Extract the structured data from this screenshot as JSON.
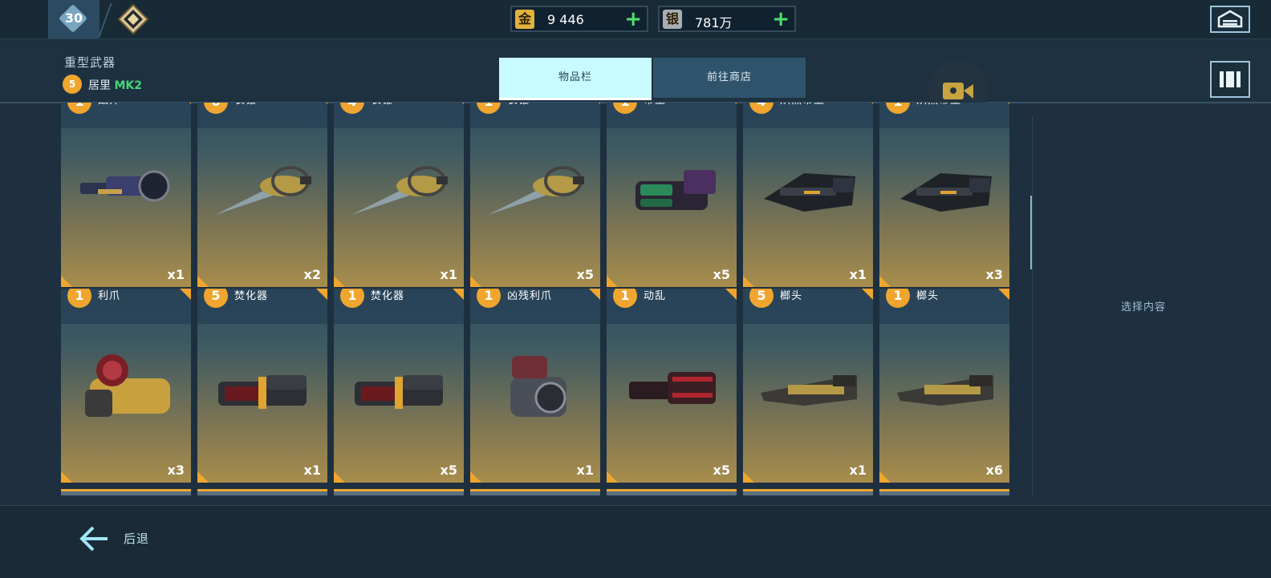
{
  "topbar": {
    "player_level": "30",
    "gold": {
      "icon_char": "金",
      "value": "9 446",
      "plus": "+"
    },
    "silver": {
      "icon_char": "银",
      "value": "781万",
      "plus": "+"
    }
  },
  "header": {
    "category_title": "重型武器",
    "bot_level": "5",
    "bot_name": "居里",
    "bot_mk": "MK2"
  },
  "tabs": [
    {
      "label": "物品栏",
      "active": true
    },
    {
      "label": "前往商店",
      "active": false
    }
  ],
  "items_row1": [
    {
      "level": "1",
      "name": "战斧",
      "qty": "x1",
      "icon": "gatling-blue"
    },
    {
      "level": "6",
      "name": "长锥",
      "qty": "x2",
      "icon": "lance-gold"
    },
    {
      "level": "4",
      "name": "长锥",
      "qty": "x1",
      "icon": "lance-gold"
    },
    {
      "level": "1",
      "name": "长锥",
      "qty": "x5",
      "icon": "lance-gold"
    },
    {
      "level": "1",
      "name": "帝王",
      "qty": "x5",
      "icon": "launcher-green"
    },
    {
      "level": "4",
      "name": "炽烈帝王",
      "qty": "x1",
      "icon": "launcher-dark"
    },
    {
      "level": "1",
      "name": "炽烈帝王",
      "qty": "x3",
      "icon": "launcher-dark"
    }
  ],
  "items_row2": [
    {
      "level": "1",
      "name": "利爪",
      "qty": "x3",
      "icon": "rocket-pod-yellow"
    },
    {
      "level": "5",
      "name": "焚化器",
      "qty": "x1",
      "icon": "cannon-red"
    },
    {
      "level": "1",
      "name": "焚化器",
      "qty": "x5",
      "icon": "cannon-red"
    },
    {
      "level": "1",
      "name": "凶残利爪",
      "qty": "x1",
      "icon": "rocket-pod-grey"
    },
    {
      "level": "1",
      "name": "动乱",
      "qty": "x5",
      "icon": "minigun-red"
    },
    {
      "level": "5",
      "name": "榔头",
      "qty": "x1",
      "icon": "railgun-gold"
    },
    {
      "level": "1",
      "name": "榔头",
      "qty": "x6",
      "icon": "railgun-gold"
    }
  ],
  "right_panel": {
    "hint": "选择内容"
  },
  "bottombar": {
    "back_label": "后退"
  },
  "colors": {
    "accent": "#f0a52e",
    "tab_active": "#c8fbff",
    "plus": "#4ee06a",
    "mk": "#45d67a"
  }
}
